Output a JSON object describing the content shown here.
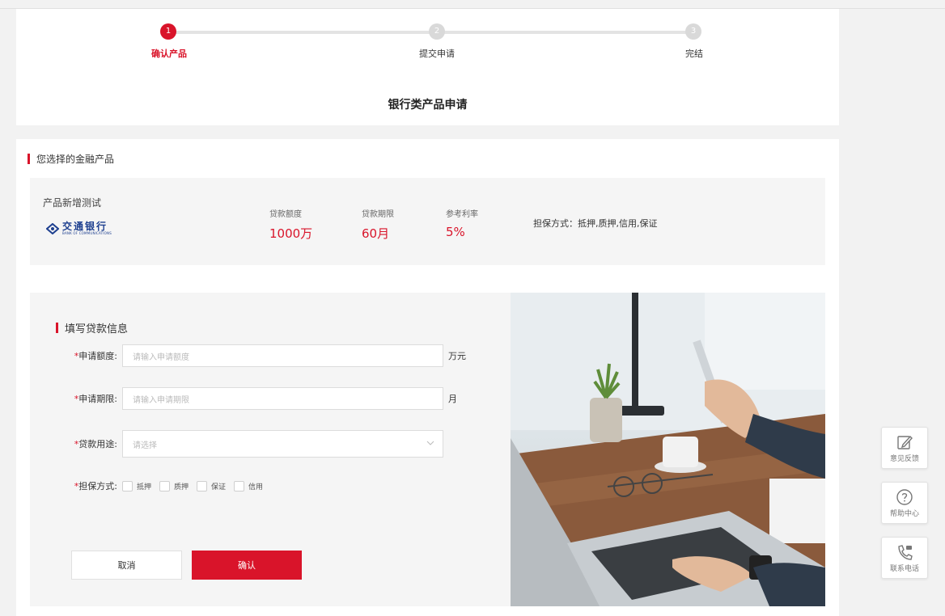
{
  "steps": [
    {
      "num": "1",
      "label": "确认产品"
    },
    {
      "num": "2",
      "label": "提交申请"
    },
    {
      "num": "3",
      "label": "完结"
    }
  ],
  "page_title": "银行类产品申请",
  "product_section_title": "您选择的金融产品",
  "product": {
    "name": "产品新增测试",
    "bank_name": "交通银行",
    "bank_name_en": "BANK OF COMMUNICATIONS",
    "stats": [
      {
        "label": "贷款额度",
        "value": "1000万"
      },
      {
        "label": "贷款期限",
        "value": "60月"
      },
      {
        "label": "参考利率",
        "value": "5%"
      }
    ],
    "guarantee_label": "担保方式：",
    "guarantee_value": "抵押,质押,信用,保证"
  },
  "form": {
    "title": "填写贷款信息",
    "required_mark": "*",
    "amount_label": "申请额度:",
    "amount_placeholder": "请输入申请额度",
    "amount_unit": "万元",
    "term_label": "申请期限:",
    "term_placeholder": "请输入申请期限",
    "term_unit": "月",
    "purpose_label": "贷款用途:",
    "purpose_placeholder": "请选择",
    "guarantee_label": "担保方式:",
    "guarantee_options": [
      "抵押",
      "质押",
      "保证",
      "信用"
    ],
    "cancel": "取消",
    "confirm": "确认"
  },
  "side_tools": [
    {
      "label": "意见反馈",
      "icon": "edit-icon"
    },
    {
      "label": "帮助中心",
      "icon": "help-icon"
    },
    {
      "label": "联系电话",
      "icon": "phone-icon"
    }
  ],
  "colors": {
    "accent": "#d9142a",
    "bank_blue": "#1d3f8f"
  }
}
